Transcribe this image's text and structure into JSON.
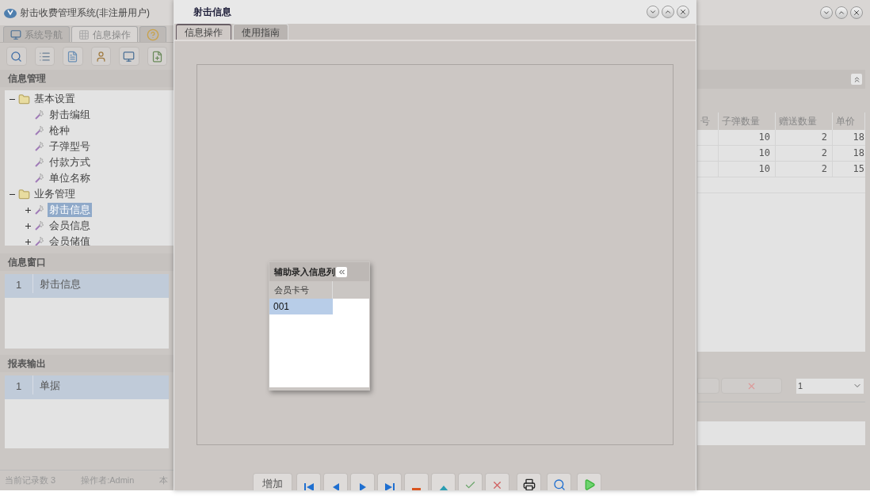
{
  "app": {
    "title": "射击收费管理系统(非注册用户)"
  },
  "main_tabs": [
    {
      "label": "系统导航",
      "kind": "monitor",
      "selected": false
    },
    {
      "label": "信息操作",
      "kind": "grid",
      "selected": true
    },
    {
      "kind": "help",
      "selected": false
    }
  ],
  "info_management": {
    "title": "信息管理",
    "tree": [
      {
        "label": "基本设置",
        "kind": "folder",
        "expanded": true,
        "selected": false,
        "children": [
          {
            "label": "射击编组",
            "kind": "leaf",
            "selected": false
          },
          {
            "label": "枪种",
            "kind": "leaf",
            "selected": false
          },
          {
            "label": "子弹型号",
            "kind": "leaf",
            "selected": false
          },
          {
            "label": "付款方式",
            "kind": "leaf",
            "selected": false
          },
          {
            "label": "单位名称",
            "kind": "leaf",
            "selected": false
          }
        ]
      },
      {
        "label": "业务管理",
        "kind": "folder",
        "expanded": true,
        "selected": false,
        "children": [
          {
            "label": "射击信息",
            "kind": "item",
            "expanded": false,
            "selected": true
          },
          {
            "label": "会员信息",
            "kind": "item",
            "expanded": false,
            "selected": false
          },
          {
            "label": "会员储值",
            "kind": "item",
            "expanded": false,
            "selected": false
          }
        ]
      }
    ]
  },
  "info_window": {
    "title": "信息窗口",
    "rows": [
      {
        "index": "1",
        "name": "射击信息",
        "selected": true
      }
    ]
  },
  "report_output": {
    "title": "报表输出",
    "rows": [
      {
        "index": "1",
        "name": "单据",
        "selected": true
      }
    ]
  },
  "status_bar": [
    "当前记录数 3",
    "操作者:Admin",
    "本"
  ],
  "right_table": {
    "columns": [
      "号",
      "子弹数量",
      "赠送数量",
      "单价"
    ],
    "rows": [
      {
        "bullet_count": "10",
        "gift_count": "2",
        "unit_price": "18"
      },
      {
        "bullet_count": "10",
        "gift_count": "2",
        "unit_price": "18"
      },
      {
        "bullet_count": "10",
        "gift_count": "2",
        "unit_price": "15"
      }
    ]
  },
  "right_select": {
    "value": "1"
  },
  "dialog": {
    "title": "射击信息",
    "tabs": [
      {
        "label": "信息操作",
        "selected": true
      },
      {
        "label": "使用指南",
        "selected": false
      }
    ],
    "popup": {
      "title": "辅助录入信息列",
      "columns": [
        "会员卡号"
      ],
      "rows": [
        {
          "value": "001",
          "selected": true
        }
      ]
    },
    "toolbar": [
      {
        "kind": "text",
        "label": "增加"
      },
      {
        "kind": "first"
      },
      {
        "kind": "prev"
      },
      {
        "kind": "next"
      },
      {
        "kind": "last"
      },
      {
        "kind": "delete"
      },
      {
        "kind": "up"
      },
      {
        "kind": "confirm"
      },
      {
        "kind": "cancel"
      },
      {
        "kind": "print"
      },
      {
        "kind": "preview"
      },
      {
        "kind": "run"
      }
    ]
  }
}
